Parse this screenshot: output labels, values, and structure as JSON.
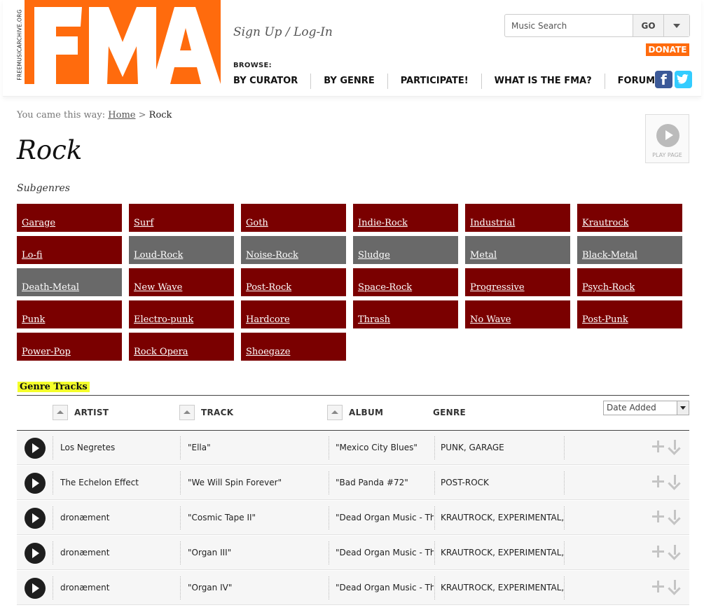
{
  "header": {
    "site_vertical": "FREEMUSICARCHIVE.ORG",
    "logo_text": "FMA",
    "signup": "Sign Up / Log-In",
    "browse_label": "BROWSE:",
    "nav": [
      "BY CURATOR",
      "BY GENRE",
      "PARTICIPATE!",
      "WHAT IS THE FMA?",
      "FORUM"
    ],
    "search_placeholder": "Music Search",
    "search_go": "GO",
    "donate": "DONATE",
    "facebook": "f"
  },
  "breadcrumb": {
    "prefix": "You came this way:",
    "home": "Home",
    "sep": ">",
    "current": "Rock"
  },
  "page_title": "Rock",
  "play_page_label": "PLAY PAGE",
  "subgenres_label": "Subgenres",
  "subgenres": [
    {
      "label": "Garage",
      "color": "#7a0000"
    },
    {
      "label": "Surf",
      "color": "#7a0000"
    },
    {
      "label": "Goth",
      "color": "#7a0000"
    },
    {
      "label": "Indie-Rock",
      "color": "#7a0000"
    },
    {
      "label": "Industrial",
      "color": "#7a0000"
    },
    {
      "label": "Krautrock",
      "color": "#7a0000"
    },
    {
      "label": "Lo-fi",
      "color": "#7a0000"
    },
    {
      "label": "Loud-Rock",
      "color": "#696969"
    },
    {
      "label": "Noise-Rock",
      "color": "#696969"
    },
    {
      "label": "Sludge",
      "color": "#696969"
    },
    {
      "label": "Metal",
      "color": "#696969"
    },
    {
      "label": "Black-Metal",
      "color": "#696969"
    },
    {
      "label": "Death-Metal",
      "color": "#696969"
    },
    {
      "label": "New Wave",
      "color": "#7a0000"
    },
    {
      "label": "Post-Rock",
      "color": "#7a0000"
    },
    {
      "label": "Space-Rock",
      "color": "#7a0000"
    },
    {
      "label": "Progressive",
      "color": "#7a0000"
    },
    {
      "label": "Psych-Rock",
      "color": "#7a0000"
    },
    {
      "label": "Punk",
      "color": "#7a0000"
    },
    {
      "label": "Electro-punk",
      "color": "#7a0000"
    },
    {
      "label": "Hardcore",
      "color": "#7a0000"
    },
    {
      "label": "Thrash",
      "color": "#7a0000"
    },
    {
      "label": "No Wave",
      "color": "#7a0000"
    },
    {
      "label": "Post-Punk",
      "color": "#7a0000"
    },
    {
      "label": "Power-Pop",
      "color": "#7a0000"
    },
    {
      "label": "Rock Opera",
      "color": "#7a0000"
    },
    {
      "label": "Shoegaze",
      "color": "#7a0000"
    }
  ],
  "tracks_section": {
    "label": "Genre Tracks",
    "columns": {
      "artist": "ARTIST",
      "track": "TRACK",
      "album": "ALBUM",
      "genre": "GENRE"
    },
    "sort_selected": "Date Added",
    "rows": [
      {
        "artist": "Los Negretes",
        "track": "\"Ella\"",
        "album": "\"Mexico City Blues\"",
        "genre": "PUNK, GARAGE"
      },
      {
        "artist": "The Echelon Effect",
        "track": "\"We Will Spin Forever\"",
        "album": "\"Bad Panda #72\"",
        "genre": "POST-ROCK"
      },
      {
        "artist": "dronæment",
        "track": "\"Cosmic Tape II\"",
        "album": "\"Dead Organ Music - The",
        "genre": "KRAUTROCK, EXPERIMENTAL, DR"
      },
      {
        "artist": "dronæment",
        "track": "\"Organ III\"",
        "album": "\"Dead Organ Music - The",
        "genre": "KRAUTROCK, EXPERIMENTAL, DR"
      },
      {
        "artist": "dronæment",
        "track": "\"Organ IV\"",
        "album": "\"Dead Organ Music - The",
        "genre": "KRAUTROCK, EXPERIMENTAL, DR"
      }
    ]
  },
  "colors": {
    "brand_orange": "#ff6b0d",
    "subgenre_red": "#7a0000",
    "subgenre_grey": "#696969",
    "highlight_yellow": "#f4ff2a"
  }
}
